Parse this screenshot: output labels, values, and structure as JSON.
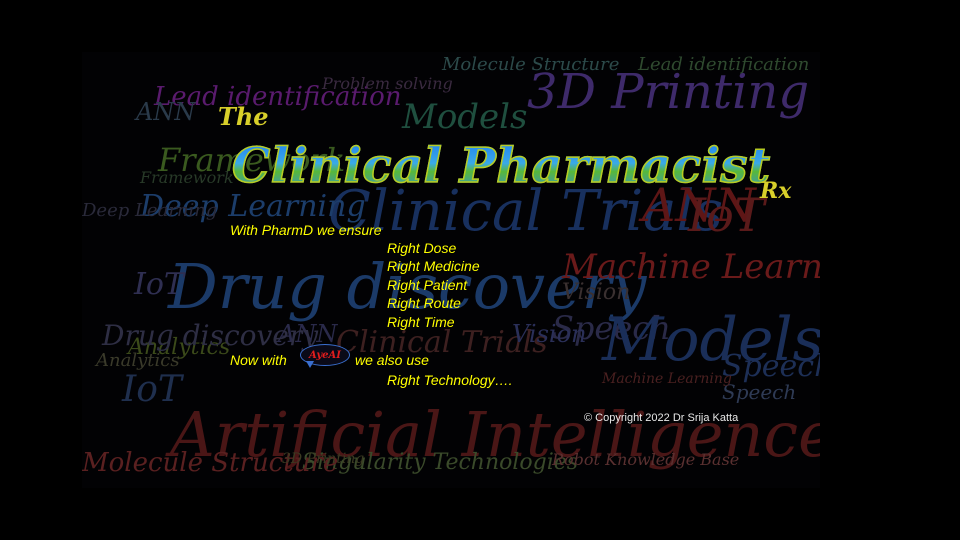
{
  "colors": {
    "background": "#000000",
    "text": "#ffff00",
    "title": "#2a8ff0",
    "badge": "#e01d1d"
  },
  "title": {
    "the": "The",
    "main": "Clinical Pharmacist",
    "rx": "Rx"
  },
  "intro": "With PharmD we ensure",
  "rights": [
    "Right Dose",
    "Right Medicine",
    "Right Patient",
    "Right Route",
    "Right Time"
  ],
  "now_with": "Now with",
  "badge": "AyeAI",
  "also_use": "we also use",
  "technology": "Right Technology….",
  "copyright": "© Copyright 2022 Dr Srija Katta",
  "cloud_words": [
    "Lead identification",
    "Models",
    "3D Printing",
    "Framework",
    "Clinical Trials",
    "Deep Learning",
    "ANN",
    "Drug discovery",
    "Machine Learning",
    "IoT",
    "Speech",
    "Vision",
    "Analytics",
    "Artificial Intelligence",
    "Molecule Structure",
    "Singularity Technologies",
    "Problem solving",
    "Lead identification",
    "Molecule Structure",
    "Robot Knowledge Base",
    "Models",
    "IoT",
    "ANN",
    "Clinical Trials",
    "Speech",
    "Drug discovery",
    "Analytics",
    "Vision",
    "Deep Learning",
    "3D Printing",
    "Framework",
    "Speech",
    "Machine Learning",
    "ANN",
    "IoT"
  ]
}
